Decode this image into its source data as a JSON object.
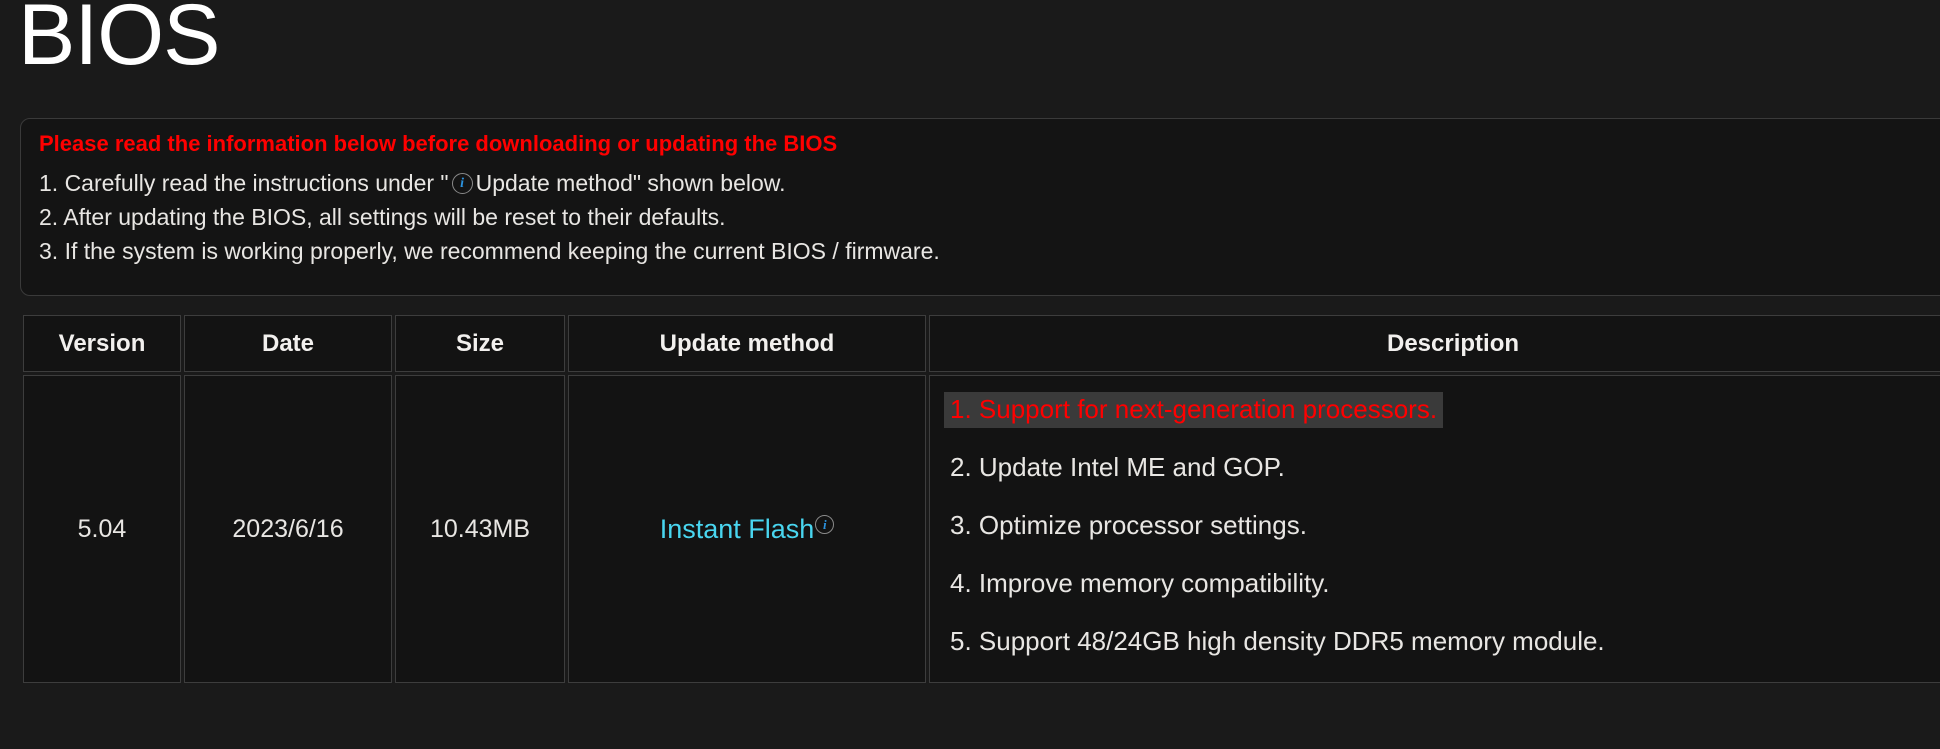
{
  "page": {
    "title": "BIOS",
    "background_color": "#1a1a1a"
  },
  "notice": {
    "heading": "Please read the information below before downloading or updating the BIOS",
    "heading_color": "#ff0000",
    "lines": [
      {
        "before_icon": "1. Carefully read the instructions under \"",
        "icon": "info-circle-icon",
        "after_icon": "Update method\" shown below."
      },
      {
        "text": "2. After updating the BIOS, all settings will be reset to their defaults."
      },
      {
        "text": "3. If the system is working properly, we recommend keeping the current BIOS / firmware."
      }
    ]
  },
  "table": {
    "headers": {
      "version": "Version",
      "date": "Date",
      "size": "Size",
      "update_method": "Update method",
      "description": "Description"
    },
    "rows": [
      {
        "version": "5.04",
        "date": "2023/6/16",
        "size": "10.43MB",
        "update_method": {
          "label": "Instant Flash",
          "link_color": "#49d6f0",
          "icon": "info-circle-icon"
        },
        "description": [
          {
            "text": "1. Support for next-generation processors.",
            "highlighted": true,
            "text_color": "#ff0000",
            "highlight_color": "#3a3a3a"
          },
          {
            "text": "2. Update Intel ME and GOP.",
            "highlighted": false
          },
          {
            "text": "3. Optimize processor settings.",
            "highlighted": false
          },
          {
            "text": "4. Improve memory compatibility.",
            "highlighted": false
          },
          {
            "text": "5. Support 48/24GB high density DDR5 memory module.",
            "highlighted": false
          }
        ]
      }
    ]
  }
}
